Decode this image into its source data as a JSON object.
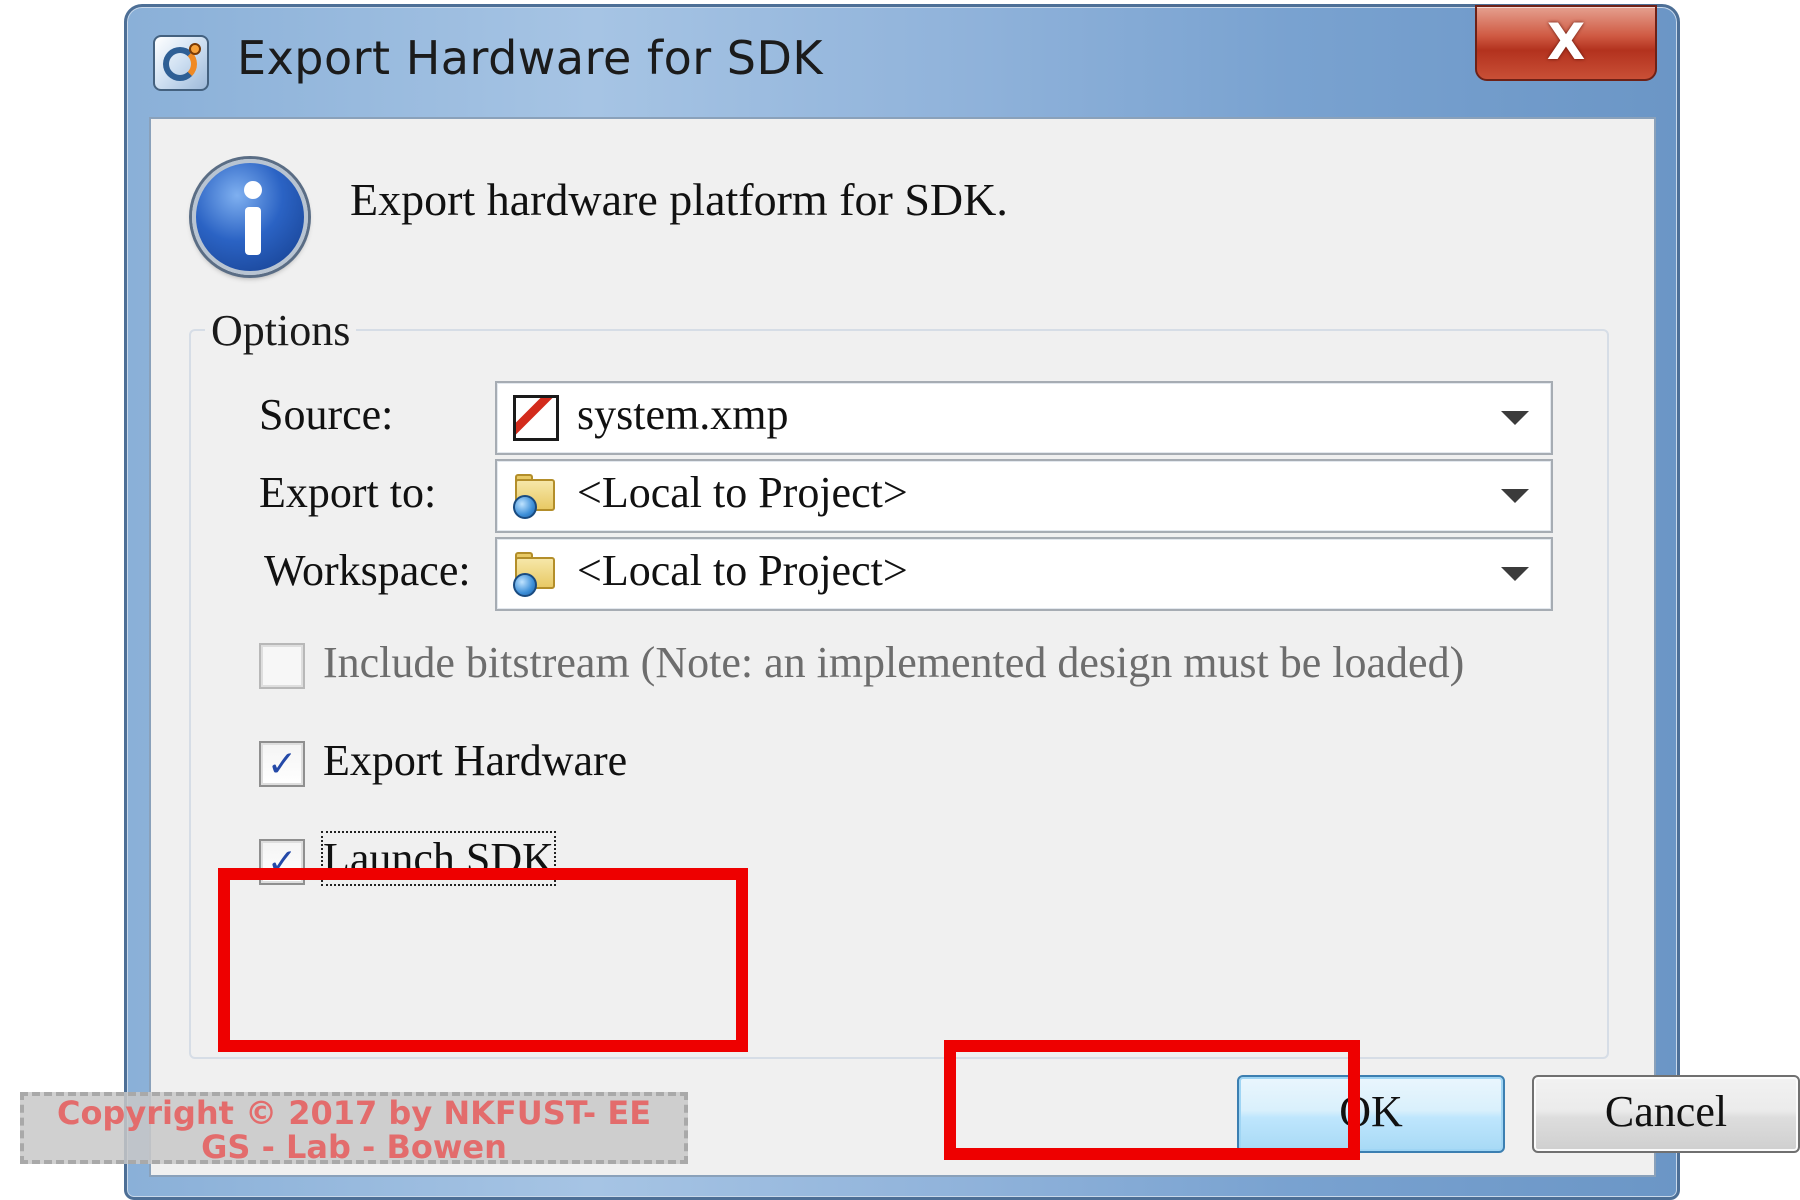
{
  "window": {
    "title": "Export Hardware for SDK",
    "close_label": "X",
    "icon": "xilinx-app-icon"
  },
  "message": {
    "icon": "info-icon",
    "text": "Export hardware platform for SDK."
  },
  "options": {
    "legend": "Options",
    "source": {
      "label": "Source:",
      "value": "system.xmp",
      "icon": "xmp-file-icon"
    },
    "export_to": {
      "label": "Export to:",
      "value": "<Local to Project>",
      "icon": "folder-globe-icon"
    },
    "workspace": {
      "label": "Workspace:",
      "value": "<Local to Project>",
      "icon": "folder-globe-icon"
    },
    "include_bitstream": {
      "label": "Include bitstream (Note: an implemented design must be loaded)",
      "checked": false,
      "enabled": false
    },
    "export_hardware": {
      "label": "Export Hardware",
      "checked": true,
      "check_glyph": "✓"
    },
    "launch_sdk": {
      "label": "Launch SDK",
      "checked": true,
      "check_glyph": "✓"
    }
  },
  "buttons": {
    "ok": "OK",
    "cancel": "Cancel"
  },
  "annotation": {
    "highlight_color": "#ee0000"
  },
  "watermark": {
    "line1": "Copyright © 2017 by NKFUST- EE",
    "line2": "GS - Lab - Bowen"
  }
}
